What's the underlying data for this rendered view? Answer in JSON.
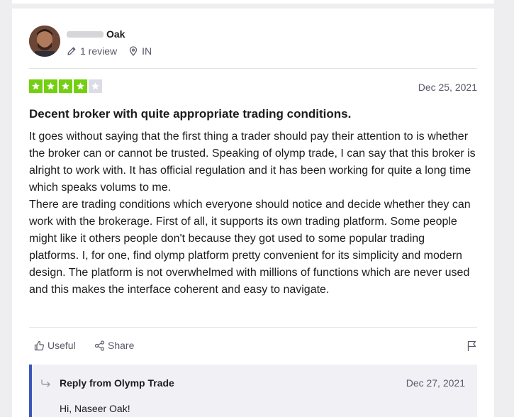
{
  "reviewer": {
    "name": "Oak",
    "review_count": "1 review",
    "country": "IN"
  },
  "review": {
    "rating": 4,
    "max_rating": 5,
    "date": "Dec 25, 2021",
    "title": "Decent broker with quite appropriate trading conditions.",
    "body": "It goes without saying that the first thing a trader should pay their attention to is whether the broker can or cannot be trusted. Speaking of olymp trade, I can say that this broker is alright to work with. It has official regulation and it has been working for quite a long time which speaks volums to me.\nThere are trading conditions which everyone should notice and decide whether they can work with the brokerage. First of all, it supports its own trading platform. Some people might like it others people don't because they got used to some popular trading platforms. I, for one, find olymp platform pretty convenient for its simplicity and modern design. The platform is not overwhelmed with millions of functions which are never used and this makes the interface coherent and easy to navigate."
  },
  "actions": {
    "useful_label": "Useful",
    "share_label": "Share"
  },
  "reply": {
    "header": "Reply from Olymp Trade",
    "date": "Dec 27, 2021",
    "text": "Hi, Naseer Oak!"
  },
  "colors": {
    "star_filled": "#73cf11",
    "star_empty": "#dcdce6",
    "reply_accent": "#3c57bc"
  },
  "icons": [
    "pencil-icon",
    "location-pin-icon",
    "star-icon",
    "thumbs-up-icon",
    "share-icon",
    "flag-icon",
    "reply-arrow-icon"
  ]
}
